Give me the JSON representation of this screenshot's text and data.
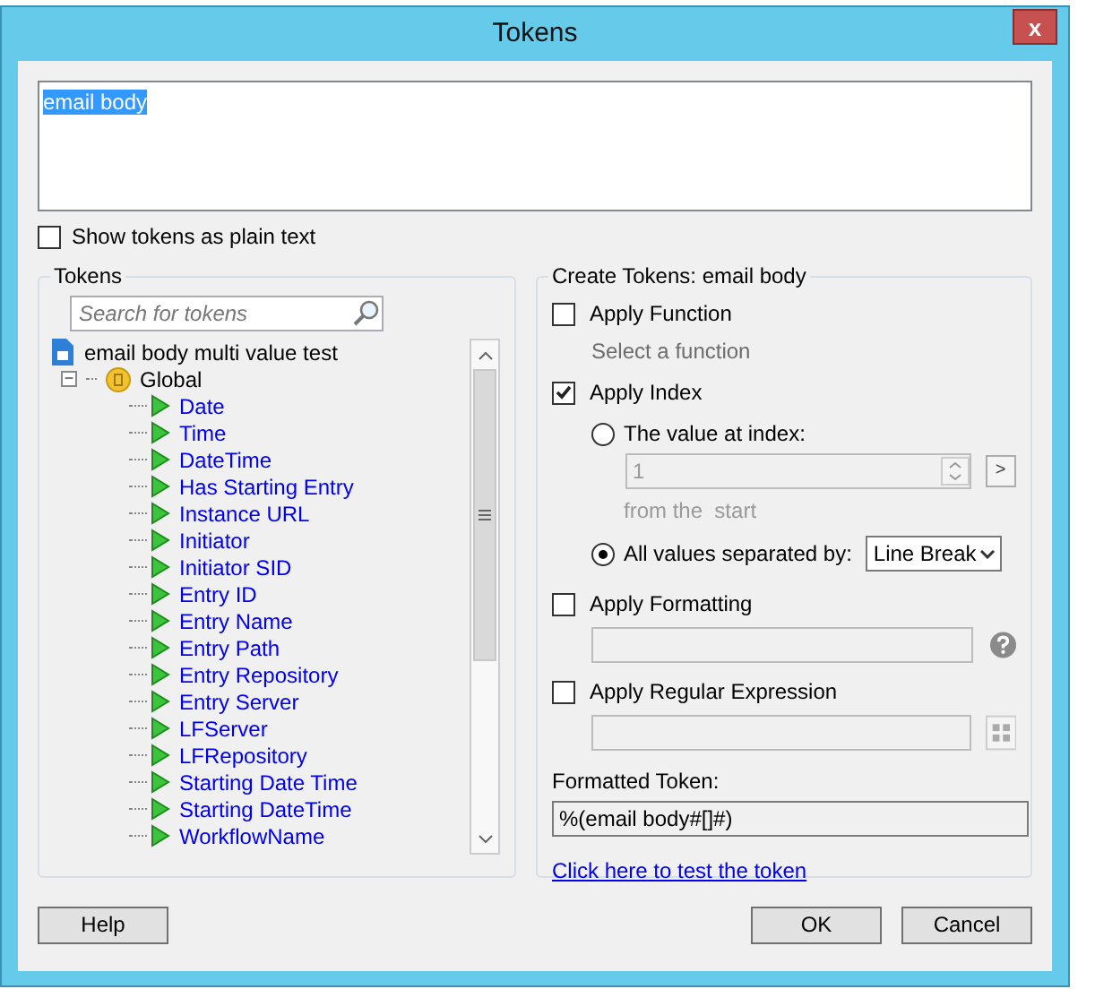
{
  "window": {
    "title": "Tokens",
    "close": "x"
  },
  "editor": {
    "value": "email body"
  },
  "show_plain": {
    "label": "Show tokens as plain text",
    "checked": false
  },
  "tokens": {
    "title": "Tokens",
    "search": {
      "placeholder": "Search for tokens"
    },
    "tree": [
      {
        "label": "email body multi value test",
        "kind": "root",
        "children": [
          {
            "label": "Global",
            "kind": "group",
            "expanded": true,
            "toggle": "−",
            "children": [
              {
                "label": "Date",
                "kind": "token"
              },
              {
                "label": "Time",
                "kind": "token"
              },
              {
                "label": "DateTime",
                "kind": "token"
              },
              {
                "label": "Has Starting Entry",
                "kind": "token"
              },
              {
                "label": "Instance URL",
                "kind": "token"
              },
              {
                "label": "Initiator",
                "kind": "token"
              },
              {
                "label": "Initiator SID",
                "kind": "token"
              },
              {
                "label": "Entry ID",
                "kind": "token"
              },
              {
                "label": "Entry Name",
                "kind": "token"
              },
              {
                "label": "Entry Path",
                "kind": "token"
              },
              {
                "label": "Entry Repository",
                "kind": "token"
              },
              {
                "label": "Entry Server",
                "kind": "token"
              },
              {
                "label": "LFServer",
                "kind": "token"
              },
              {
                "label": "LFRepository",
                "kind": "token"
              },
              {
                "label": "Starting Date Time",
                "kind": "token"
              },
              {
                "label": "Starting DateTime",
                "kind": "token"
              },
              {
                "label": "WorkflowName",
                "kind": "token"
              }
            ]
          }
        ]
      }
    ]
  },
  "create": {
    "title": "Create Tokens: email body",
    "apply_function": {
      "label": "Apply Function",
      "checked": false,
      "hint": "Select a function"
    },
    "apply_index": {
      "label": "Apply Index",
      "checked": true,
      "radios": [
        {
          "label": "The value at index:",
          "selected": false,
          "value": "1",
          "note": "from the  start",
          "button": ">"
        },
        {
          "label": "All values separated by:",
          "selected": true,
          "dropdown": "Line Break"
        }
      ]
    },
    "apply_formatting": {
      "label": "Apply Formatting",
      "checked": false
    },
    "apply_regex": {
      "label": "Apply Regular Expression",
      "checked": false
    },
    "formatted": {
      "label": "Formatted Token:",
      "value": "%(email body#[]#)"
    },
    "test_link": "Click here to test the token"
  },
  "buttons": [
    {
      "label": "Help",
      "kind": "left"
    },
    {
      "label": "OK",
      "kind": "right"
    },
    {
      "label": "Cancel",
      "kind": "right"
    }
  ]
}
